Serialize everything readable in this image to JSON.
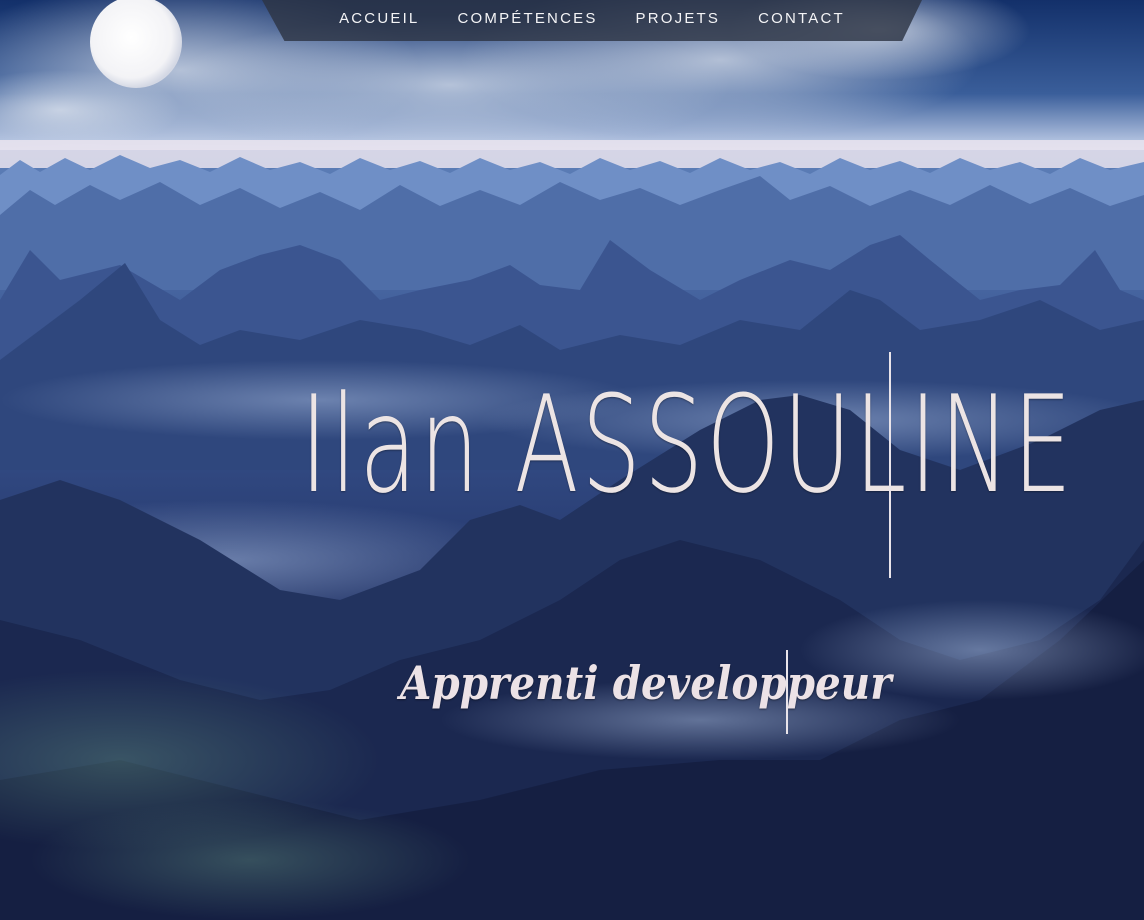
{
  "nav": {
    "items": [
      {
        "label": "ACCUEIL"
      },
      {
        "label": "COMPÉTENCES"
      },
      {
        "label": "PROJETS"
      },
      {
        "label": "CONTACT"
      }
    ]
  },
  "hero": {
    "name": "Ilan ASSOULINE",
    "subtitle": "Apprenti developpeur",
    "background_image": "mountain-landscape-with-moon",
    "colors": {
      "text": "#ece4e4",
      "nav_bar": "#2d3444",
      "sky": "#1c3a7a",
      "mountains": "#2a3f74"
    }
  }
}
